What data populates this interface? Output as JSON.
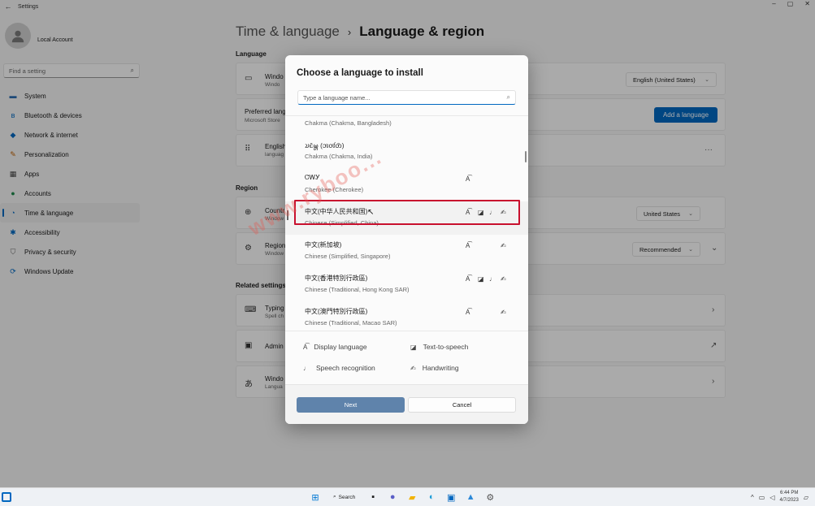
{
  "window": {
    "title": "Settings",
    "back_glyph": "←",
    "min": "–",
    "max": "▢",
    "close": "✕"
  },
  "account": {
    "name": "Local Account"
  },
  "sidebar": {
    "search_placeholder": "Find a setting",
    "items": [
      {
        "label": "System",
        "icon": "monitor-icon",
        "glyph": "▬",
        "color": "#2b6cb0"
      },
      {
        "label": "Bluetooth & devices",
        "icon": "bluetooth-icon",
        "glyph": "ʙ",
        "color": "#0067c0"
      },
      {
        "label": "Network & internet",
        "icon": "wifi-icon",
        "glyph": "◆",
        "color": "#0067c0"
      },
      {
        "label": "Personalization",
        "icon": "brush-icon",
        "glyph": "✎",
        "color": "#c06000"
      },
      {
        "label": "Apps",
        "icon": "apps-icon",
        "glyph": "▦",
        "color": "#444"
      },
      {
        "label": "Accounts",
        "icon": "person-icon",
        "glyph": "●",
        "color": "#1f8a4c"
      },
      {
        "label": "Time & language",
        "icon": "clock-globe-icon",
        "glyph": "◔",
        "color": "#0067c0"
      },
      {
        "label": "Accessibility",
        "icon": "accessibility-icon",
        "glyph": "✱",
        "color": "#0067c0"
      },
      {
        "label": "Privacy & security",
        "icon": "shield-icon",
        "glyph": "⛉",
        "color": "#666"
      },
      {
        "label": "Windows Update",
        "icon": "update-icon",
        "glyph": "⟳",
        "color": "#0067c0"
      }
    ]
  },
  "main": {
    "breadcrumb_parent": "Time & language",
    "breadcrumb_sep": "›",
    "breadcrumb_current": "Language & region",
    "language_section": "Language",
    "windows_display_language_title": "Windo",
    "windows_display_language_sub": "Windo",
    "windows_display_language_value": "English (United States)",
    "preferred_title": "Preferred lang",
    "preferred_sub": "Microsoft Store",
    "add_language_button": "Add a language",
    "english_title": "English",
    "english_sub": "languag",
    "more_glyph": "···",
    "region_section": "Region",
    "country_title": "Countr",
    "country_sub": "Window",
    "country_value": "United States",
    "regional_title": "Region",
    "regional_sub": "Window",
    "regional_value": "Recommended",
    "related_section": "Related settings",
    "typing_title": "Typing",
    "typing_sub": "Spell ch",
    "admin_title": "Admin",
    "windows_lang_title": "Windo",
    "windows_lang_sub": "Langua"
  },
  "dialog": {
    "title": "Choose a language to install",
    "search_placeholder": "Type a language name...",
    "languages": [
      {
        "native": "",
        "english": "Chakma (Chakma, Bangladesh)",
        "caps": []
      },
      {
        "native": "𑄌𑄋𑄴𑄟𑄳𑄦 (𑄞𑄢𑄧𑄖𑄴)",
        "english": "Chakma (Chakma, India)",
        "caps": []
      },
      {
        "native": "ᏣᎳᎩ",
        "english": "Cherokee (Cherokee)",
        "caps": [
          "display"
        ]
      },
      {
        "native": "中文(中华人民共和国)",
        "english": "Chinese (Simplified, China)",
        "caps": [
          "display",
          "tts",
          "speech",
          "handwriting"
        ]
      },
      {
        "native": "中文(新加坡)",
        "english": "Chinese (Simplified, Singapore)",
        "caps": [
          "display",
          "handwriting"
        ]
      },
      {
        "native": "中文(香港特別行政區)",
        "english": "Chinese (Traditional, Hong Kong SAR)",
        "caps": [
          "display",
          "tts",
          "speech",
          "handwriting"
        ]
      },
      {
        "native": "中文(澳門特別行政區)",
        "english": "Chinese (Traditional, Macao SAR)",
        "caps": [
          "display",
          "handwriting"
        ]
      }
    ],
    "legend": {
      "display": "Display language",
      "tts": "Text-to-speech",
      "speech": "Speech recognition",
      "handwriting": "Handwriting"
    },
    "next_button": "Next",
    "cancel_button": "Cancel"
  },
  "watermark": "www.ryboo...",
  "taskbar": {
    "search_label": "Search",
    "time": "6:44 PM",
    "date": "4/7/2023",
    "tray_chevron": "^"
  }
}
